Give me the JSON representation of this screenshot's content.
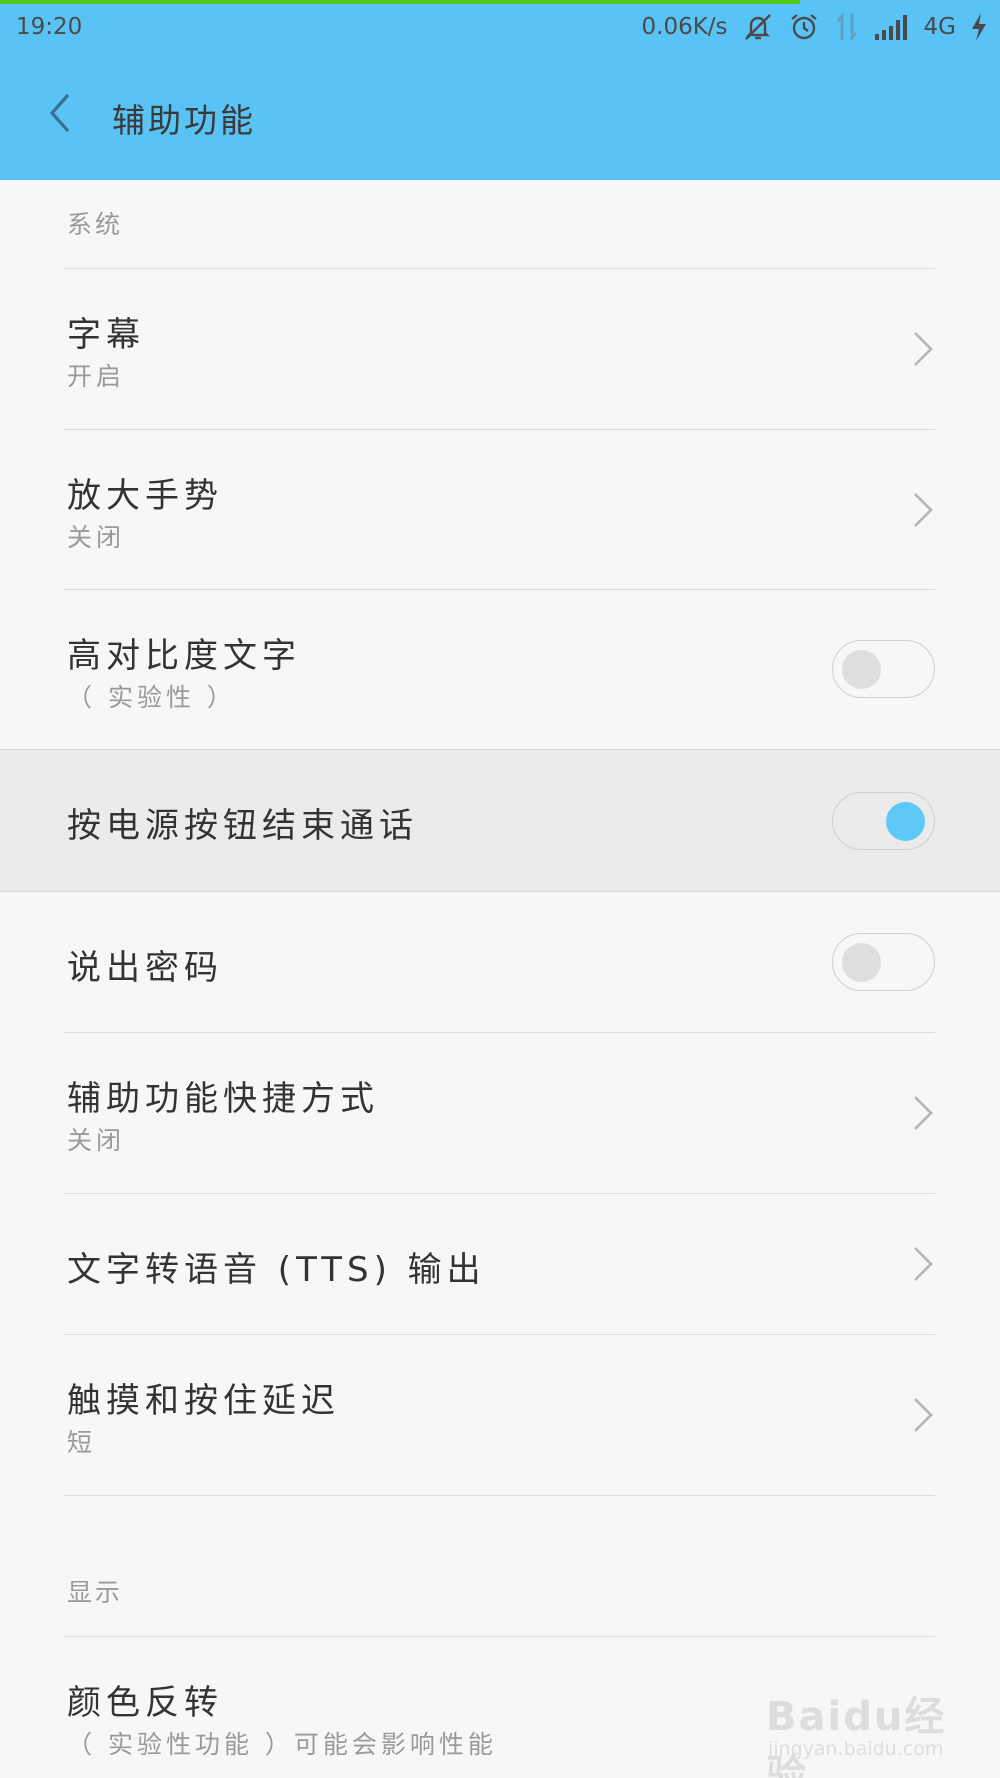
{
  "status_bar": {
    "time": "19:20",
    "net_speed": "0.06K/s",
    "network": "4G",
    "icons": [
      "mute-icon",
      "alarm-icon",
      "data-arrows-icon",
      "signal-icon",
      "charging-icon"
    ]
  },
  "app_bar": {
    "title": "辅助功能",
    "back_icon": "chevron-left-icon"
  },
  "sections": {
    "system": "系统",
    "display": "显示"
  },
  "items": {
    "captions": {
      "title": "字幕",
      "subtitle": "开启"
    },
    "magnify": {
      "title": "放大手势",
      "subtitle": "关闭"
    },
    "high_contrast": {
      "title": "高对比度文字",
      "subtitle": "（ 实验性 ）",
      "enabled": false
    },
    "power_end_call": {
      "title": "按电源按钮结束通话",
      "enabled": true
    },
    "speak_password": {
      "title": "说出密码",
      "enabled": false
    },
    "shortcut": {
      "title": "辅助功能快捷方式",
      "subtitle": "关闭"
    },
    "tts": {
      "title": "文字转语音 (TTS) 输出"
    },
    "touch_delay": {
      "title": "触摸和按住延迟",
      "subtitle": "短"
    },
    "color_invert": {
      "title": "颜色反转",
      "subtitle": "（ 实验性功能 ）可能会影响性能"
    }
  },
  "watermark": {
    "text": "Baidu经验",
    "url": "jingyan.baidu.com"
  },
  "colors": {
    "accent": "#59c3f6",
    "toggle_on": "#5ec8f7",
    "progress": "#50c81e"
  }
}
